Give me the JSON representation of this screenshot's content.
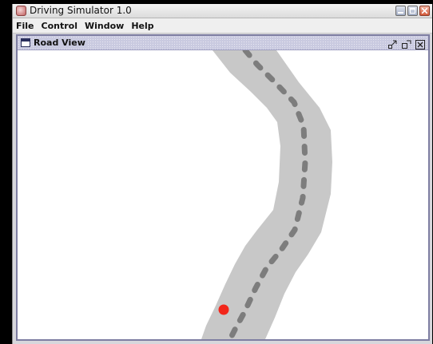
{
  "app": {
    "title": "Driving Simulator 1.0"
  },
  "menu": {
    "items": [
      "File",
      "Control",
      "Window",
      "Help"
    ]
  },
  "internal_frame": {
    "title": "Road View"
  },
  "colors": {
    "road": "#c8c8c8",
    "lane_marking": "#7d7d7d",
    "car": "#f2261a",
    "frame_border": "#7e7ea2"
  },
  "icons": {
    "app": "app-icon",
    "window_buttons": [
      "minimize-icon",
      "maximize-icon",
      "close-icon"
    ],
    "frame_icon": "frame-icon",
    "frame_buttons": [
      "iconify-icon",
      "restore-icon",
      "close-icon"
    ]
  }
}
